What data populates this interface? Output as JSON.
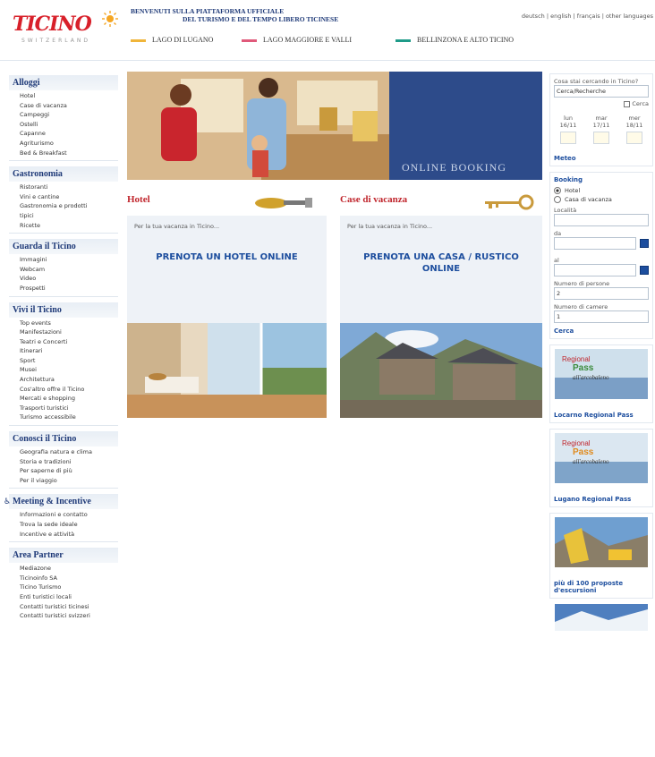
{
  "header": {
    "logo_text": "TICINO",
    "logo_sub": "SWITZERLAND",
    "welcome_line1": "BENVENUTI SULLA PIATTAFORMA UFFICIALE",
    "welcome_line2": "DEL TURISMO E DEL TEMPO LIBERO TICINESE",
    "languages": [
      "deutsch",
      "english",
      "français",
      "other languages"
    ],
    "regions": [
      {
        "label": "LAGO DI LUGANO",
        "color": "#f0b53a"
      },
      {
        "label": "LAGO MAGGIORE E VALLI",
        "color": "#e0597a"
      },
      {
        "label": "BELLINZONA E ALTO TICINO",
        "color": "#1f9b89"
      }
    ]
  },
  "leftnav": [
    {
      "title": "Alloggi",
      "items": [
        "Hotel",
        "Case di vacanza",
        "Campeggi",
        "Ostelli",
        "Capanne",
        "Agriturismo",
        "Bed & Breakfast"
      ]
    },
    {
      "title": "Gastronomia",
      "items": [
        "Ristoranti",
        "Vini e cantine",
        "Gastronomia e prodotti",
        "tipici",
        "Ricette"
      ]
    },
    {
      "title": "Guarda il Ticino",
      "items": [
        "Immagini",
        "Webcam",
        "Video",
        "Prospetti"
      ]
    },
    {
      "title": "Vivi il Ticino",
      "items": [
        "Top events",
        "Manifestazioni",
        "Teatri e Concerti",
        "Itinerari",
        "Sport",
        "Musei",
        "Architettura",
        "Cos'altro offre il Ticino",
        "Mercati e shopping",
        "Trasporti turistici",
        "Turismo accessibile"
      ]
    },
    {
      "title": "Conosci il Ticino",
      "items": [
        "Geografia natura e clima",
        "Storia e tradizioni",
        "Per saperne di più",
        "Per il viaggio"
      ]
    },
    {
      "title": "Meeting & Incentive",
      "items": [
        "Informazioni e contatto",
        "Trova la sede ideale",
        "Incentive e attività"
      ]
    },
    {
      "title": "Area Partner",
      "items": [
        "Mediazone",
        "Ticinoinfo SA",
        "Ticino Turismo",
        "Enti turistici locali",
        "Contatti turistici ticinesi",
        "Contatti turistici svizzeri"
      ]
    }
  ],
  "main": {
    "hero_text": "ONLINE BOOKING",
    "hotel": {
      "title": "Hotel",
      "subtitle": "Per la tua vacanza in Ticino...",
      "cta": "PRENOTA UN HOTEL ONLINE"
    },
    "house": {
      "title": "Case di vacanza",
      "subtitle": "Per la tua vacanza in Ticino...",
      "cta_line1": "PRENOTA UNA CASA / RUSTICO",
      "cta_line2": "ONLINE"
    }
  },
  "right": {
    "search_question": "Cosa stai cercando in Ticino?",
    "search_value": "Cerca/Recherche",
    "search_check": "Cerca",
    "weather": [
      {
        "day": "lun",
        "date": "16/11"
      },
      {
        "day": "mar",
        "date": "17/11"
      },
      {
        "day": "mer",
        "date": "18/11"
      }
    ],
    "meteo_link": "Meteo",
    "booking_title": "Booking",
    "booking_opt1": "Hotel",
    "booking_opt2": "Casa di vacanza",
    "lbl_localita": "Località",
    "lbl_da": "da",
    "lbl_al": "al",
    "lbl_persone": "Numero di persone",
    "val_persone": "2",
    "lbl_camere": "Numero di camere",
    "val_camere": "1",
    "cerca": "Cerca",
    "promo1_caption": "Locarno Regional Pass",
    "promo2_caption": "Lugano Regional Pass",
    "promo3_caption": "più di 100 proposte d'escursioni",
    "promo_badge_top": "Regional",
    "promo_badge_pass": "Pass",
    "promo_badge_mid": "all'arcobaleno"
  }
}
